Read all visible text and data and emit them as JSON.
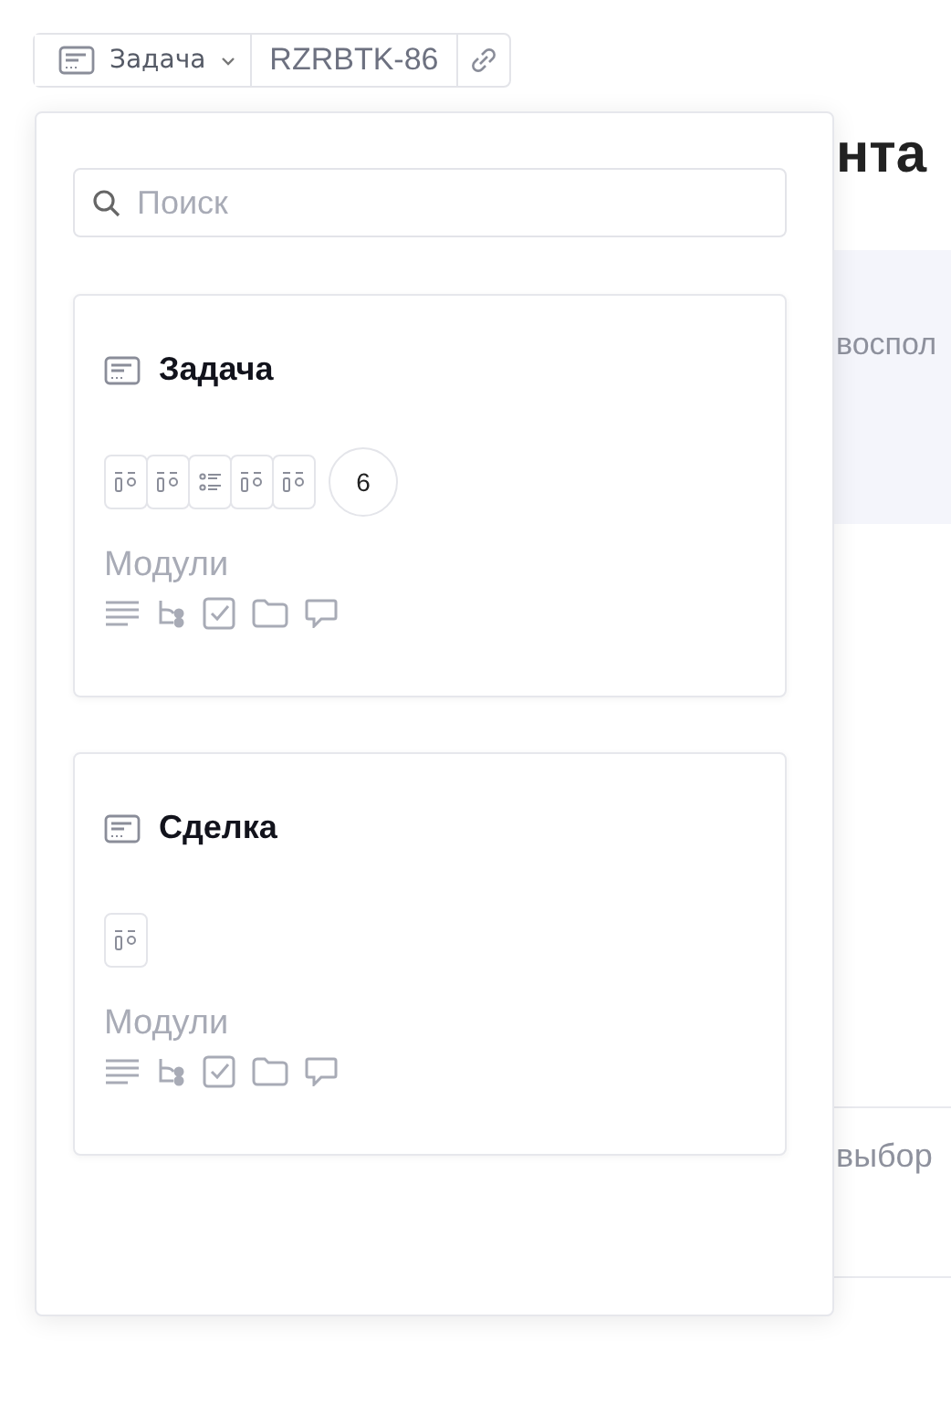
{
  "header": {
    "type_button": {
      "label": "Задача"
    },
    "key": "RZRBTK-86"
  },
  "background": {
    "heading": "нта",
    "banner_text": "воспол",
    "row_text": "выбор"
  },
  "popup": {
    "search": {
      "placeholder": "Поиск"
    },
    "cards": [
      {
        "title": "Задача",
        "fields": [
          {
            "kind": "field"
          },
          {
            "kind": "field"
          },
          {
            "kind": "list"
          },
          {
            "kind": "field"
          },
          {
            "kind": "field"
          }
        ],
        "count": "6",
        "modules_label": "Модули"
      },
      {
        "title": "Сделка",
        "fields": [
          {
            "kind": "field"
          }
        ],
        "modules_label": "Модули"
      }
    ]
  }
}
